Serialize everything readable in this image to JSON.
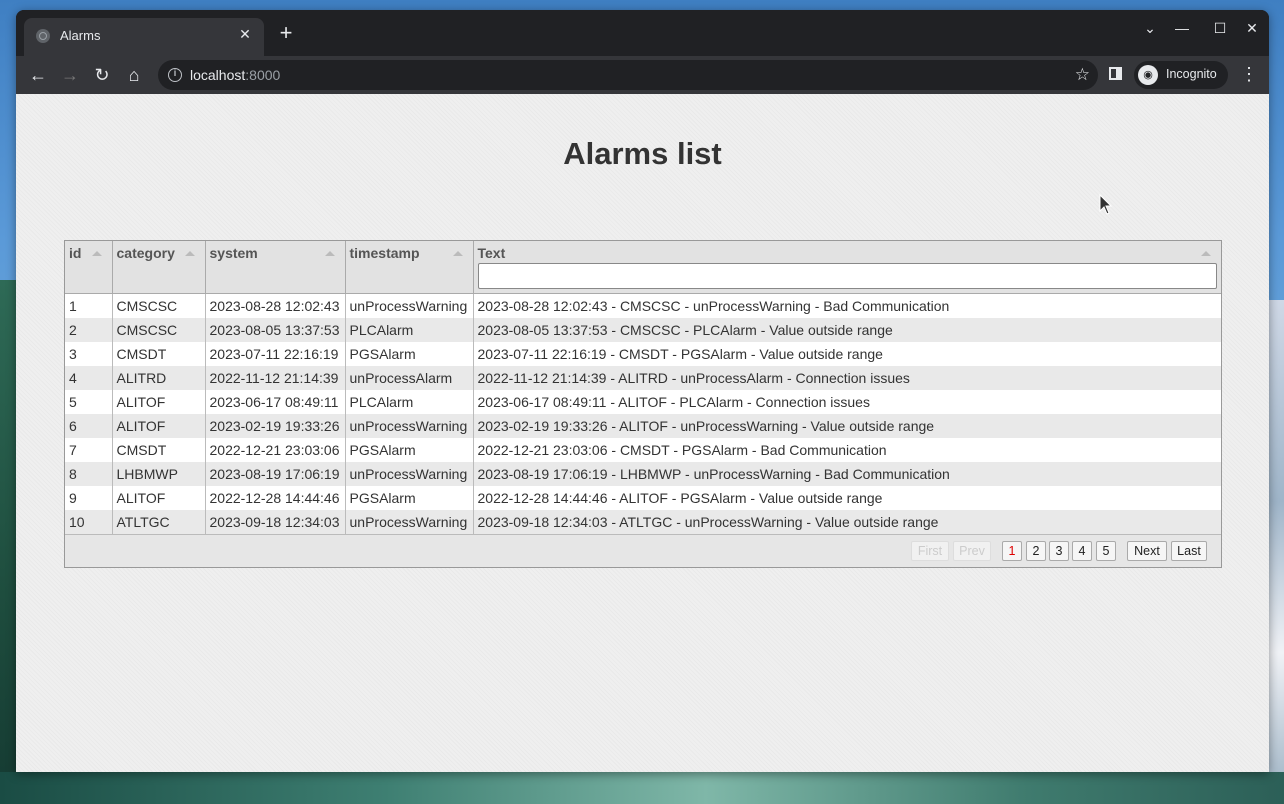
{
  "browser": {
    "tab_title": "Alarms",
    "tab_close": "✕",
    "new_tab": "+",
    "url_host": "localhost",
    "url_port": ":8000",
    "profile_label": "Incognito",
    "icons": [
      "back-icon",
      "forward-icon",
      "reload-icon",
      "home-icon",
      "info-icon",
      "star-icon",
      "side-panel-icon",
      "incognito-icon",
      "menu-icon"
    ]
  },
  "page": {
    "title": "Alarms list"
  },
  "table": {
    "columns": [
      "id",
      "category",
      "system",
      "timestamp",
      "Text"
    ],
    "rows": [
      [
        "1",
        "CMSCSC",
        "2023-08-28 12:02:43",
        "unProcessWarning",
        "2023-08-28 12:02:43 - CMSCSC - unProcessWarning - Bad Communication"
      ],
      [
        "2",
        "CMSCSC",
        "2023-08-05 13:37:53",
        "PLCAlarm",
        "2023-08-05 13:37:53 - CMSCSC - PLCAlarm - Value outside range"
      ],
      [
        "3",
        "CMSDT",
        "2023-07-11 22:16:19",
        "PGSAlarm",
        "2023-07-11 22:16:19 - CMSDT - PGSAlarm - Value outside range"
      ],
      [
        "4",
        "ALITRD",
        "2022-11-12 21:14:39",
        "unProcessAlarm",
        "2022-11-12 21:14:39 - ALITRD - unProcessAlarm - Connection issues"
      ],
      [
        "5",
        "ALITOF",
        "2023-06-17 08:49:11",
        "PLCAlarm",
        "2023-06-17 08:49:11 - ALITOF - PLCAlarm - Connection issues"
      ],
      [
        "6",
        "ALITOF",
        "2023-02-19 19:33:26",
        "unProcessWarning",
        "2023-02-19 19:33:26 - ALITOF - unProcessWarning - Value outside range"
      ],
      [
        "7",
        "CMSDT",
        "2022-12-21 23:03:06",
        "PGSAlarm",
        "2022-12-21 23:03:06 - CMSDT - PGSAlarm - Bad Communication"
      ],
      [
        "8",
        "LHBMWP",
        "2023-08-19 17:06:19",
        "unProcessWarning",
        "2023-08-19 17:06:19 - LHBMWP - unProcessWarning - Bad Communication"
      ],
      [
        "9",
        "ALITOF",
        "2022-12-28 14:44:46",
        "PGSAlarm",
        "2022-12-28 14:44:46 - ALITOF - PGSAlarm - Value outside range"
      ],
      [
        "10",
        "ATLTGC",
        "2023-09-18 12:34:03",
        "unProcessWarning",
        "2023-09-18 12:34:03 - ATLTGC - unProcessWarning - Value outside range"
      ]
    ]
  },
  "pagination": {
    "first": "First",
    "prev": "Prev",
    "pages": [
      "1",
      "2",
      "3",
      "4",
      "5"
    ],
    "current_page": "1",
    "next": "Next",
    "last": "Last"
  }
}
